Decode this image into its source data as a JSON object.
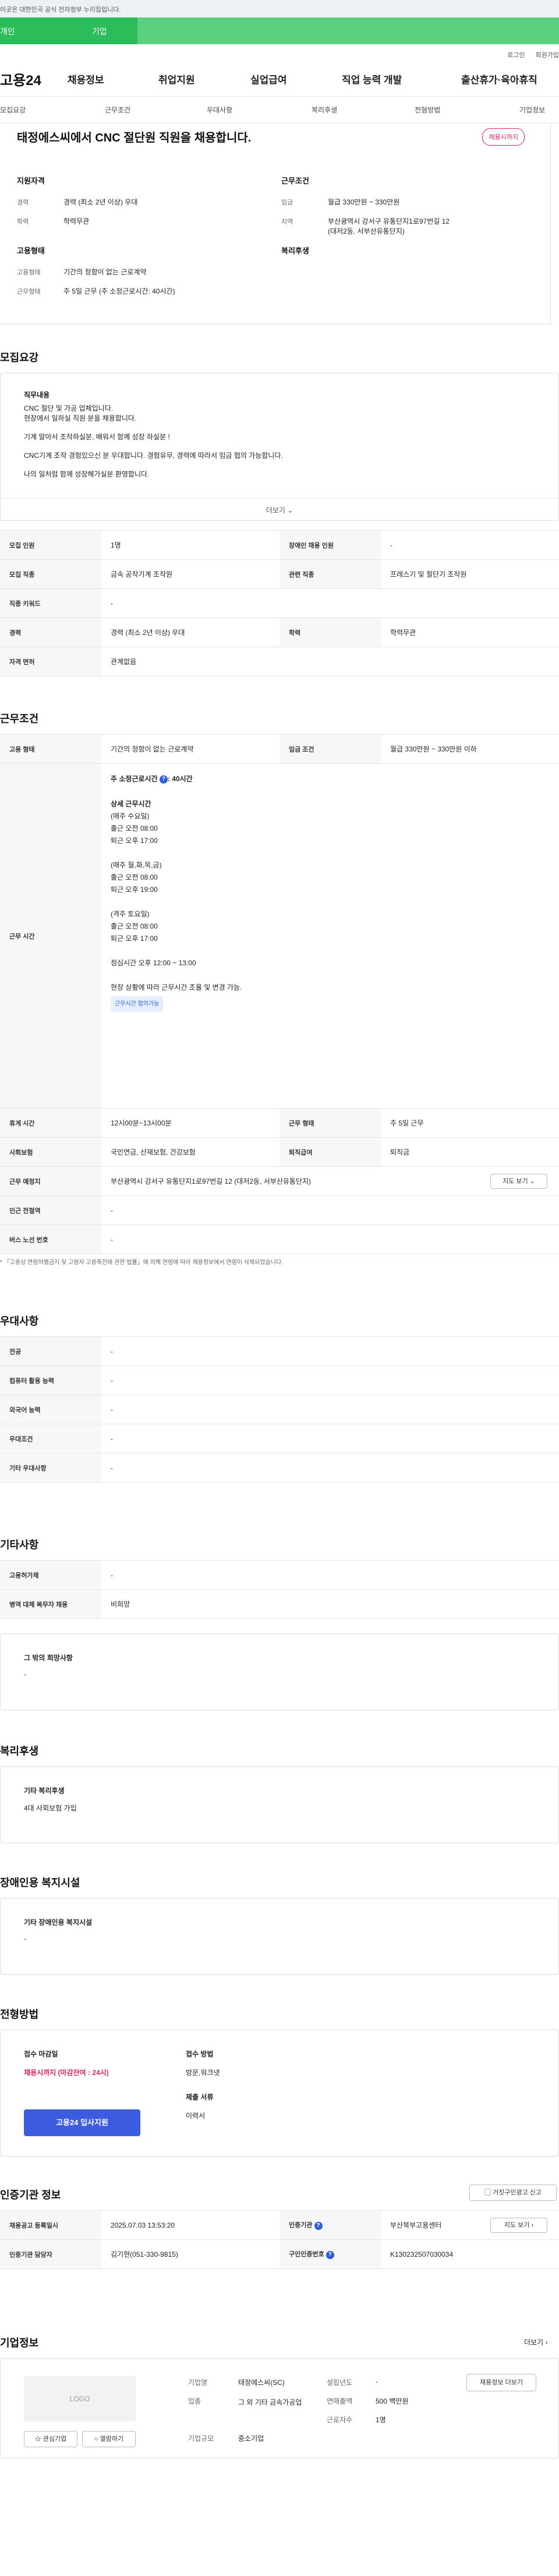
{
  "gov_banner": "이곳은 대한민국 공식 전자정부 누리집입니다.",
  "user_tabs": [
    "개인",
    "기업"
  ],
  "util_links": [
    "로그인",
    "회원가입"
  ],
  "logo": "고용24",
  "gnb": [
    "채용정보",
    "취업지원",
    "실업급여",
    "직업 능력 개발",
    "출산휴가·육아휴직"
  ],
  "subnav": [
    "모집요강",
    "근무조건",
    "우대사항",
    "복리후생",
    "전형방법",
    "기업정보"
  ],
  "hero": {
    "title": "태정에스씨에서 CNC 절단원 직원을 채용합니다.",
    "badge": "채용시까지",
    "left_heading1": "지원자격",
    "left_rows1": [
      {
        "k": "경력",
        "v": "경력 (최소 2년 이상) 우대"
      },
      {
        "k": "학력",
        "v": "학력무관"
      }
    ],
    "left_heading2": "고용형태",
    "left_rows2": [
      {
        "k": "고용형태",
        "v": "기간의 정함이 없는 근로계약"
      },
      {
        "k": "근무형태",
        "v": "주 5일 근무 (주 소정근로시간: 40시간)"
      }
    ],
    "right_heading1": "근무조건",
    "right_rows1": [
      {
        "k": "임금",
        "v": "월급 330만원 ~ 330만원"
      },
      {
        "k": "지역",
        "v": "부산광역시 강서구 유통단지1로97번길 12 (대저2동, 서부산유통단지)"
      }
    ],
    "right_heading2": "복리후생"
  },
  "recruit": {
    "title": "모집요강",
    "duty_heading": "직무내용",
    "duty_lines": [
      "CNC 절단 및 가공 업체입니다.",
      "현장에서 일하실 직원 분을 채용합니다.",
      "기계 알아서 조작하실분, 배워서 함께 성장 하실분 !",
      "CNC기계 조작 경험있으신 분 우대합니다. 경험유무, 경력에 따라서 임금 협의 가능합니다.",
      " 나의 일처럼 함께 성장해가실분 환영합니다."
    ],
    "more": "더보기",
    "rows": [
      {
        "k1": "모집 인원",
        "v1": "1명",
        "k2": "장애인 채용 인원",
        "v2": "-"
      },
      {
        "k1": "모집 직종",
        "v1": "금속 공작기계 조작원",
        "k2": "관련 직종",
        "v2": "프레스기 및 절단기 조작원"
      },
      {
        "k1": "직종 키워드",
        "v1": "-"
      },
      {
        "k1": "경력",
        "v1": "경력 (최소 2년 이상) 우대",
        "k2": "학력",
        "v2": "학력무관"
      },
      {
        "k1": "자격 면허",
        "v1": "관계없음"
      }
    ]
  },
  "work": {
    "title": "근무조건",
    "r1": {
      "k1": "고용 형태",
      "v1": "기간의 정함이 없는 근로계약",
      "k2": "임금 조건",
      "v2": "월급 330만원 ~ 330만원 이하"
    },
    "hours_label": "근무 시간",
    "hours_top": "주 소정근로시간",
    "hours_top_val": ": 40시간",
    "hours_lines": [
      "상세 근무시간",
      "(매주 수요일)",
      "출근 오전 08:00",
      "퇴근 오후 17:00",
      "",
      "(매주 월,화,목,금)",
      "출근 오전 08:00",
      "퇴근 오후 19:00",
      "",
      "(격주 토요일)",
      "출근 오전 08:00",
      "퇴근 오후 17:00",
      "",
      "점심시간 오후 12:00 ~ 13:00",
      "",
      "현장 상황에 따라 근무시간 조율 및 변경 가능."
    ],
    "hours_pill": "근무시간 협의가능",
    "r3": {
      "k1": "휴게 시간",
      "v1": "12시00분~13시00분",
      "k2": "근무 형태",
      "v2": "주 5일 근무"
    },
    "r4": {
      "k1": "사회보험",
      "v1": "국민연금, 산재보험, 건강보험",
      "k2": "퇴직급여",
      "v2": "퇴직금"
    },
    "r5": {
      "k1": "근무 예정지",
      "v1": "부산광역시 강서구 유통단지1로97번길 12 (대저2동, 서부산유통단지)",
      "btn": "지도 보기"
    },
    "r6": {
      "k1": "인근 전철역",
      "v1": "-"
    },
    "r7": {
      "k1": "버스 노선 번호",
      "v1": "-"
    },
    "note": "* 「고용상 연령차별금지 및 고령자 고용촉진에 관한 법률」에 의해 연령에 따라 채용정보에서 연령이 삭제되었습니다."
  },
  "pref": {
    "title": "우대사항",
    "rows": [
      {
        "k": "전공",
        "v": "-"
      },
      {
        "k": "컴퓨터 활용 능력",
        "v": "-"
      },
      {
        "k": "외국어 능력",
        "v": "-"
      },
      {
        "k": "우대조건",
        "v": "-"
      },
      {
        "k": "기타 우대사항",
        "v": "-"
      }
    ]
  },
  "etc": {
    "title": "기타사항",
    "rows": [
      {
        "k": "고용허가제",
        "v": "-"
      },
      {
        "k": "병역 대체 복무자 채용",
        "v": "비희망"
      }
    ],
    "box_heading": "그 밖의 희망사항",
    "box_value": "-"
  },
  "welfare": {
    "title": "복리후생",
    "heading": "기타 복리후생",
    "value": "4대 사회보험 가입"
  },
  "disability": {
    "title": "장애인용 복지시설",
    "heading": "기타 장애인용 복지시설",
    "value": "-"
  },
  "selection": {
    "title": "전형방법",
    "deadline_label": "접수 마감일",
    "deadline_value": "채용시까지 (마감잔여 : 24시)",
    "apply_btn": "고용24 입사지원",
    "method_label": "접수 방법",
    "method_value": "방문,워크넷",
    "doc_label": "제출 서류",
    "doc_value": "이력서"
  },
  "agency": {
    "title": "인증기관 정보",
    "report_btn": "거짓구인광고 신고",
    "r1": {
      "k1": "채용공고 등록일시",
      "v1": "2025.07.03 13:53:20",
      "k2": "인증기관",
      "v2": "부산북부고용센터",
      "btn": "지도 보기"
    },
    "r2": {
      "k1": "인증기관 담당자",
      "v1": "김기현(051-330-9815)",
      "k2": "구인인증번호",
      "v2": "K130232507030034"
    }
  },
  "company": {
    "title": "기업정보",
    "more": "더보기",
    "logo_text": "LOGO",
    "fav_btn": "관심기업",
    "bookmark_btn": "열람하기",
    "fields": [
      {
        "k": "기업명",
        "v": "태정에스씨(SC)"
      },
      {
        "k": "업종",
        "v": "그 외 기타 금속가공업"
      },
      {
        "k": "기업규모",
        "v": "중소기업"
      }
    ],
    "fields2": [
      {
        "k": "설립년도",
        "v": "-"
      },
      {
        "k": "연매출액",
        "v": "500 백만원"
      },
      {
        "k": "근로자수",
        "v": "1명"
      }
    ],
    "recruit_btn": "채용정보 더보기"
  },
  "colors": {
    "green": "#2bbd5a",
    "pink": "#e3245f",
    "blue": "#3d5be0"
  }
}
